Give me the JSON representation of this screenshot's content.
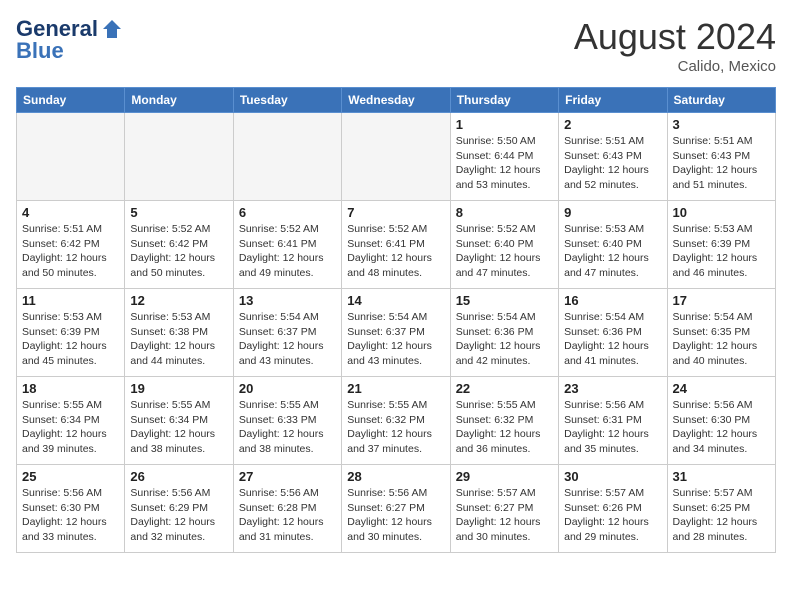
{
  "header": {
    "logo_general": "General",
    "logo_blue": "Blue",
    "month_year": "August 2024",
    "location": "Calido, Mexico"
  },
  "calendar": {
    "days_of_week": [
      "Sunday",
      "Monday",
      "Tuesday",
      "Wednesday",
      "Thursday",
      "Friday",
      "Saturday"
    ],
    "weeks": [
      [
        {
          "day": "",
          "info": ""
        },
        {
          "day": "",
          "info": ""
        },
        {
          "day": "",
          "info": ""
        },
        {
          "day": "",
          "info": ""
        },
        {
          "day": "1",
          "info": "Sunrise: 5:50 AM\nSunset: 6:44 PM\nDaylight: 12 hours\nand 53 minutes."
        },
        {
          "day": "2",
          "info": "Sunrise: 5:51 AM\nSunset: 6:43 PM\nDaylight: 12 hours\nand 52 minutes."
        },
        {
          "day": "3",
          "info": "Sunrise: 5:51 AM\nSunset: 6:43 PM\nDaylight: 12 hours\nand 51 minutes."
        }
      ],
      [
        {
          "day": "4",
          "info": "Sunrise: 5:51 AM\nSunset: 6:42 PM\nDaylight: 12 hours\nand 50 minutes."
        },
        {
          "day": "5",
          "info": "Sunrise: 5:52 AM\nSunset: 6:42 PM\nDaylight: 12 hours\nand 50 minutes."
        },
        {
          "day": "6",
          "info": "Sunrise: 5:52 AM\nSunset: 6:41 PM\nDaylight: 12 hours\nand 49 minutes."
        },
        {
          "day": "7",
          "info": "Sunrise: 5:52 AM\nSunset: 6:41 PM\nDaylight: 12 hours\nand 48 minutes."
        },
        {
          "day": "8",
          "info": "Sunrise: 5:52 AM\nSunset: 6:40 PM\nDaylight: 12 hours\nand 47 minutes."
        },
        {
          "day": "9",
          "info": "Sunrise: 5:53 AM\nSunset: 6:40 PM\nDaylight: 12 hours\nand 47 minutes."
        },
        {
          "day": "10",
          "info": "Sunrise: 5:53 AM\nSunset: 6:39 PM\nDaylight: 12 hours\nand 46 minutes."
        }
      ],
      [
        {
          "day": "11",
          "info": "Sunrise: 5:53 AM\nSunset: 6:39 PM\nDaylight: 12 hours\nand 45 minutes."
        },
        {
          "day": "12",
          "info": "Sunrise: 5:53 AM\nSunset: 6:38 PM\nDaylight: 12 hours\nand 44 minutes."
        },
        {
          "day": "13",
          "info": "Sunrise: 5:54 AM\nSunset: 6:37 PM\nDaylight: 12 hours\nand 43 minutes."
        },
        {
          "day": "14",
          "info": "Sunrise: 5:54 AM\nSunset: 6:37 PM\nDaylight: 12 hours\nand 43 minutes."
        },
        {
          "day": "15",
          "info": "Sunrise: 5:54 AM\nSunset: 6:36 PM\nDaylight: 12 hours\nand 42 minutes."
        },
        {
          "day": "16",
          "info": "Sunrise: 5:54 AM\nSunset: 6:36 PM\nDaylight: 12 hours\nand 41 minutes."
        },
        {
          "day": "17",
          "info": "Sunrise: 5:54 AM\nSunset: 6:35 PM\nDaylight: 12 hours\nand 40 minutes."
        }
      ],
      [
        {
          "day": "18",
          "info": "Sunrise: 5:55 AM\nSunset: 6:34 PM\nDaylight: 12 hours\nand 39 minutes."
        },
        {
          "day": "19",
          "info": "Sunrise: 5:55 AM\nSunset: 6:34 PM\nDaylight: 12 hours\nand 38 minutes."
        },
        {
          "day": "20",
          "info": "Sunrise: 5:55 AM\nSunset: 6:33 PM\nDaylight: 12 hours\nand 38 minutes."
        },
        {
          "day": "21",
          "info": "Sunrise: 5:55 AM\nSunset: 6:32 PM\nDaylight: 12 hours\nand 37 minutes."
        },
        {
          "day": "22",
          "info": "Sunrise: 5:55 AM\nSunset: 6:32 PM\nDaylight: 12 hours\nand 36 minutes."
        },
        {
          "day": "23",
          "info": "Sunrise: 5:56 AM\nSunset: 6:31 PM\nDaylight: 12 hours\nand 35 minutes."
        },
        {
          "day": "24",
          "info": "Sunrise: 5:56 AM\nSunset: 6:30 PM\nDaylight: 12 hours\nand 34 minutes."
        }
      ],
      [
        {
          "day": "25",
          "info": "Sunrise: 5:56 AM\nSunset: 6:30 PM\nDaylight: 12 hours\nand 33 minutes."
        },
        {
          "day": "26",
          "info": "Sunrise: 5:56 AM\nSunset: 6:29 PM\nDaylight: 12 hours\nand 32 minutes."
        },
        {
          "day": "27",
          "info": "Sunrise: 5:56 AM\nSunset: 6:28 PM\nDaylight: 12 hours\nand 31 minutes."
        },
        {
          "day": "28",
          "info": "Sunrise: 5:56 AM\nSunset: 6:27 PM\nDaylight: 12 hours\nand 30 minutes."
        },
        {
          "day": "29",
          "info": "Sunrise: 5:57 AM\nSunset: 6:27 PM\nDaylight: 12 hours\nand 30 minutes."
        },
        {
          "day": "30",
          "info": "Sunrise: 5:57 AM\nSunset: 6:26 PM\nDaylight: 12 hours\nand 29 minutes."
        },
        {
          "day": "31",
          "info": "Sunrise: 5:57 AM\nSunset: 6:25 PM\nDaylight: 12 hours\nand 28 minutes."
        }
      ]
    ]
  }
}
